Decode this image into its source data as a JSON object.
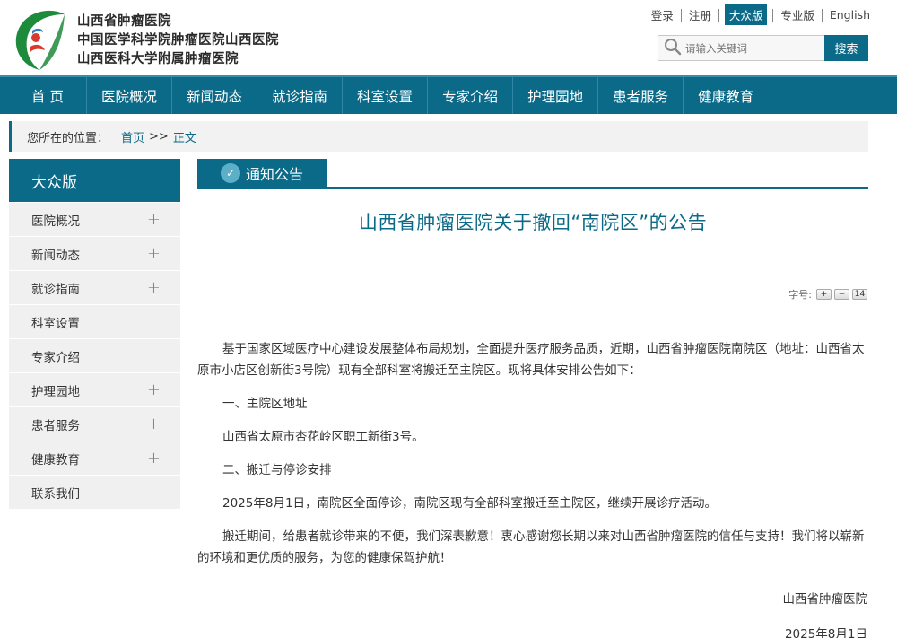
{
  "header": {
    "name_lines": [
      "山西省肿瘤医院",
      "中国医学科学院肿瘤医院山西医院",
      "山西医科大学附属肿瘤医院"
    ],
    "top_links": {
      "login": "登录",
      "register": "注册",
      "public_version": "大众版",
      "pro_version": "专业版",
      "english": "English"
    },
    "search": {
      "placeholder": "请输入关键词",
      "button": "搜索"
    }
  },
  "nav": {
    "items": [
      "首 页",
      "医院概况",
      "新闻动态",
      "就诊指南",
      "科室设置",
      "专家介绍",
      "护理园地",
      "患者服务",
      "健康教育"
    ]
  },
  "breadcrumb": {
    "prefix": "您所在的位置：",
    "home": "首页",
    "sep": ">>",
    "current": "正文"
  },
  "sidebar": {
    "title": "大众版",
    "items": [
      {
        "label": "医院概况",
        "expand": "+"
      },
      {
        "label": "新闻动态",
        "expand": "+"
      },
      {
        "label": "就诊指南",
        "expand": "+"
      },
      {
        "label": "科室设置",
        "expand": ""
      },
      {
        "label": "专家介绍",
        "expand": ""
      },
      {
        "label": "护理园地",
        "expand": "+"
      },
      {
        "label": "患者服务",
        "expand": "+"
      },
      {
        "label": "健康教育",
        "expand": "+"
      },
      {
        "label": "联系我们",
        "expand": ""
      }
    ]
  },
  "article": {
    "section_tab": "通知公告",
    "title": "山西省肿瘤医院关于撤回“南院区”的公告",
    "font_size_label": "字号:",
    "font_buttons": [
      "+",
      "−",
      "14"
    ],
    "paragraphs": [
      "基于国家区域医疗中心建设发展整体布局规划，全面提升医疗服务品质，近期，山西省肿瘤医院南院区（地址：山西省太原市小店区创新街3号院）现有全部科室将搬迁至主院区。现将具体安排公告如下：",
      "一、主院区地址",
      "山西省太原市杏花岭区职工新街3号。",
      "二、搬迁与停诊安排",
      "2025年8月1日，南院区全面停诊，南院区现有全部科室搬迁至主院区，继续开展诊疗活动。",
      "搬迁期间，给患者就诊带来的不便，我们深表歉意！衷心感谢您长期以来对山西省肿瘤医院的信任与支持！我们将以崭新的环境和更优质的服务，为您的健康保驾护航！"
    ],
    "signature": "山西省肿瘤医院",
    "date": "2025年8月1日"
  },
  "colors": {
    "primary": "#0b6a88",
    "logo_green": "#1e8a3c",
    "logo_red": "#d93a2b"
  }
}
